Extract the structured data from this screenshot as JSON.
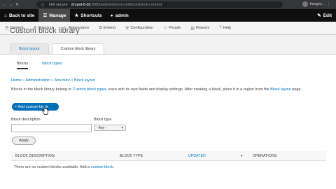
{
  "browser": {
    "not_secure": "Not secure",
    "domain": "drupal-8.dd",
    "path": ":8083/admin/structure/block/block-content",
    "profile": "Incogni..."
  },
  "toolbar": {
    "back": "Back to site",
    "manage": "Manage",
    "shortcuts": "Shortcuts",
    "user": "admin",
    "edit": "Edit"
  },
  "tray": {
    "items": [
      {
        "icon": "☰",
        "label": "Content"
      },
      {
        "icon": "⎈",
        "label": "Structure"
      },
      {
        "icon": "✎",
        "label": "Appearance"
      },
      {
        "icon": "⧉",
        "label": "Extend"
      },
      {
        "icon": "⚒",
        "label": "Configuration"
      },
      {
        "icon": "☺",
        "label": "People"
      },
      {
        "icon": "▥",
        "label": "Reports"
      },
      {
        "icon": "?",
        "label": "Help"
      }
    ]
  },
  "page": {
    "title": "Custom block library",
    "tabs": [
      "Block layout",
      "Custom block library"
    ],
    "subtabs": [
      "Blocks",
      "Block types"
    ],
    "breadcrumb": [
      "Home",
      "Administration",
      "Structure",
      "Block layout"
    ],
    "desc_1": "Blocks in the block library belong to ",
    "desc_link_1": "Custom block types",
    "desc_2": ", each with its own fields and display settings. After creating a block, place it in a region from the ",
    "desc_link_2": "Block layout",
    "desc_3": " page.",
    "add_button": "+ Add custom block",
    "filter_desc_label": "Block description",
    "filter_type_label": "Block type",
    "filter_type_value": "- Any -",
    "apply": "Apply",
    "columns": [
      "BLOCK DESCRIPTION",
      "BLOCK TYPE",
      "UPDATED",
      "OPERATIONS"
    ],
    "empty_text": "There are no custom blocks available. Add a ",
    "empty_link": "custom block",
    "empty_end": "."
  }
}
